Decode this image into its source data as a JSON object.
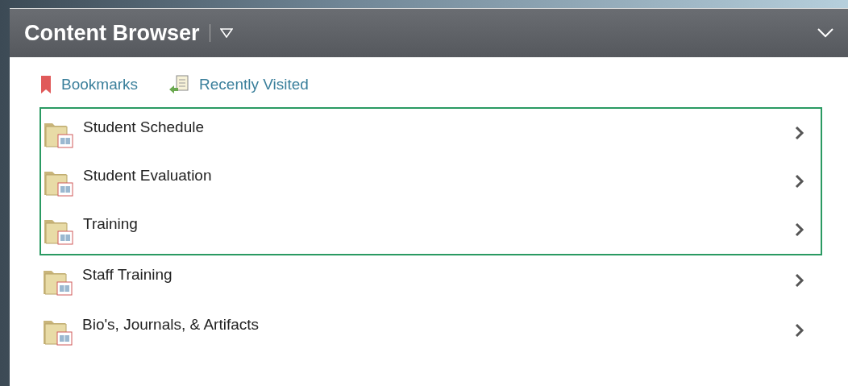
{
  "panel": {
    "title": "Content Browser"
  },
  "links": [
    {
      "kind": "bookmark",
      "label": "Bookmarks"
    },
    {
      "kind": "recent",
      "label": "Recently Visited"
    }
  ],
  "items": [
    {
      "label": "Student Schedule",
      "highlighted": true
    },
    {
      "label": "Student Evaluation",
      "highlighted": true
    },
    {
      "label": "Training",
      "highlighted": true
    },
    {
      "label": "Staff Training",
      "highlighted": false
    },
    {
      "label": "Bio's, Journals, & Artifacts",
      "highlighted": false
    }
  ]
}
